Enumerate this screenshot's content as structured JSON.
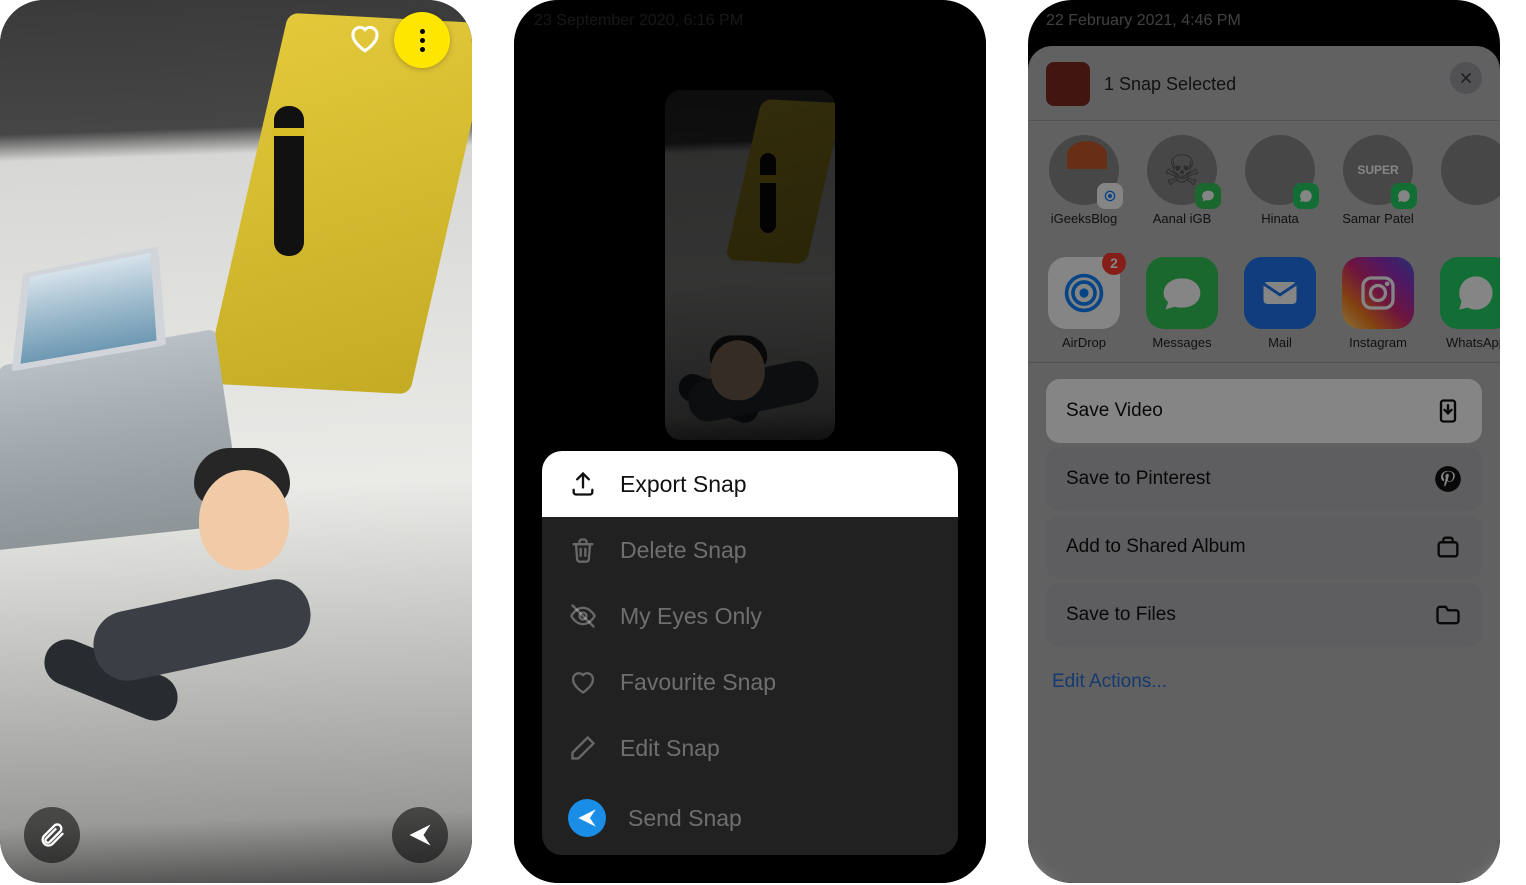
{
  "screen1": {
    "more_button": "more-options",
    "heart": "favourite",
    "paperclip": "attachment",
    "send": "send"
  },
  "screen2": {
    "timestamp": "23 September 2020, 6:16 PM",
    "actions": {
      "export": "Export Snap",
      "delete": "Delete Snap",
      "eyes": "My Eyes Only",
      "favourite": "Favourite Snap",
      "edit": "Edit Snap",
      "send": "Send Snap"
    }
  },
  "screen3": {
    "timestamp": "22 February 2021, 4:46 PM",
    "title": "1 Snap Selected",
    "contacts": [
      {
        "name": "iGeeksBlog",
        "badge": "airdrop"
      },
      {
        "name": "Aanal iGB",
        "badge": "messages"
      },
      {
        "name": "Hinata",
        "badge": "whatsapp"
      },
      {
        "name": "Samar Patel",
        "badge": "whatsapp"
      }
    ],
    "apps": [
      {
        "name": "AirDrop",
        "badge_count": "2"
      },
      {
        "name": "Messages"
      },
      {
        "name": "Mail"
      },
      {
        "name": "Instagram"
      },
      {
        "name": "WhatsApp"
      }
    ],
    "actions": {
      "save_video": "Save Video",
      "pinterest": "Save to Pinterest",
      "shared_album": "Add to Shared Album",
      "files": "Save to Files"
    },
    "edit_actions": "Edit Actions..."
  }
}
